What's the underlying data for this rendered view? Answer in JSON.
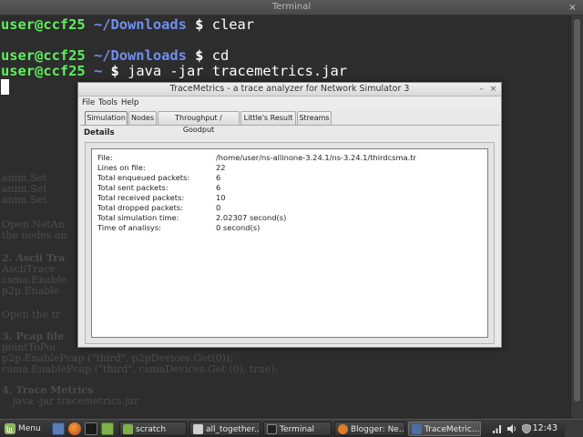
{
  "terminal": {
    "title": "Terminal",
    "close_glyph": "×",
    "lines": [
      {
        "user": "user@ccf25",
        "path": "~/Downloads",
        "symbol": "$",
        "command": "clear"
      },
      {
        "user": "user@ccf25",
        "path": "~/Downloads",
        "symbol": "$",
        "command": "cd"
      },
      {
        "user": "user@ccf25",
        "path": "~",
        "symbol": "$",
        "command": "java -jar tracemetrics.jar"
      }
    ]
  },
  "background_doc": {
    "lines": [
      {
        "text": "anim.Set",
        "bold": false
      },
      {
        "text": "anim.Set",
        "bold": false
      },
      {
        "text": "anim.Set",
        "bold": false
      },
      {
        "text": "Open NetAn",
        "bold": false
      },
      {
        "text": "the nodes an",
        "bold": false
      },
      {
        "text": "2. Ascii Tra",
        "bold": true
      },
      {
        "text": "AsciiTrace",
        "bold": false
      },
      {
        "text": "csma.Enable",
        "bold": false
      },
      {
        "text": "p2p.Enable",
        "bold": false
      },
      {
        "text": "Open the tr",
        "bold": false
      },
      {
        "text": "3. Pcap file",
        "bold": true
      },
      {
        "text": "pointToPoi",
        "bold": false
      },
      {
        "text": "p2p.EnablePcap (\"third\", p2pDevices.Get(0));",
        "bold": false
      },
      {
        "text": "csma.EnablePcap (\"third\", csmaDevices.Get (0), true);",
        "bold": false
      },
      {
        "text": "4. Trace Metrics",
        "bold": true
      },
      {
        "text": "java -jar tracemetrics.jar",
        "bold": false
      }
    ]
  },
  "tracemetrics": {
    "title": "TraceMetrics - a trace analyzer for Network Simulator 3",
    "minimize_glyph": "–",
    "close_glyph": "×",
    "menu": [
      "File",
      "Tools",
      "Help"
    ],
    "tabs": [
      {
        "label": "Simulation",
        "active": true
      },
      {
        "label": "Nodes",
        "active": false
      },
      {
        "label": "Throughput / Goodput",
        "active": false
      },
      {
        "label": "Little's Result",
        "active": false
      },
      {
        "label": "Streams",
        "active": false
      }
    ],
    "details_label": "Details",
    "details": [
      {
        "label": "File:",
        "value": "/home/user/ns-allinone-3.24.1/ns-3.24.1/thirdcsma.tr"
      },
      {
        "label": "Lines on file:",
        "value": "22"
      },
      {
        "label": "Total enqueued packets:",
        "value": "6"
      },
      {
        "label": "Total sent packets:",
        "value": "6"
      },
      {
        "label": "Total received packets:",
        "value": "10"
      },
      {
        "label": "Total dropped packets:",
        "value": "0"
      },
      {
        "label": "Total simulation time:",
        "value": "2.02307 second(s)"
      },
      {
        "label": "Time of analisys:",
        "value": "0 second(s)"
      }
    ]
  },
  "taskbar": {
    "menu_label": "Menu",
    "tasks": [
      {
        "label": "scratch",
        "active": false,
        "icon_color": "#7fb04a"
      },
      {
        "label": "all_together...",
        "active": false,
        "icon_color": "#d0d0d0"
      },
      {
        "label": "Terminal",
        "active": false,
        "icon_color": "#222222"
      },
      {
        "label": "Blogger: Ne...",
        "active": false,
        "icon_color": "#e07b2a"
      },
      {
        "label": "TraceMetric...",
        "active": true,
        "icon_color": "#4a6fa5"
      }
    ],
    "clock": "12:43"
  },
  "colors": {
    "prompt_user": "#5ef05e",
    "prompt_path": "#6f8fef",
    "terminal_bg": "#2d2d2d",
    "mint_green": "#87b657"
  },
  "icons": {
    "menu": "mint-logo-icon",
    "launchers": [
      "desktop-icon",
      "firefox-icon",
      "terminal-icon",
      "files-icon"
    ],
    "tray": [
      "network-icon",
      "volume-icon",
      "shield-icon"
    ]
  }
}
